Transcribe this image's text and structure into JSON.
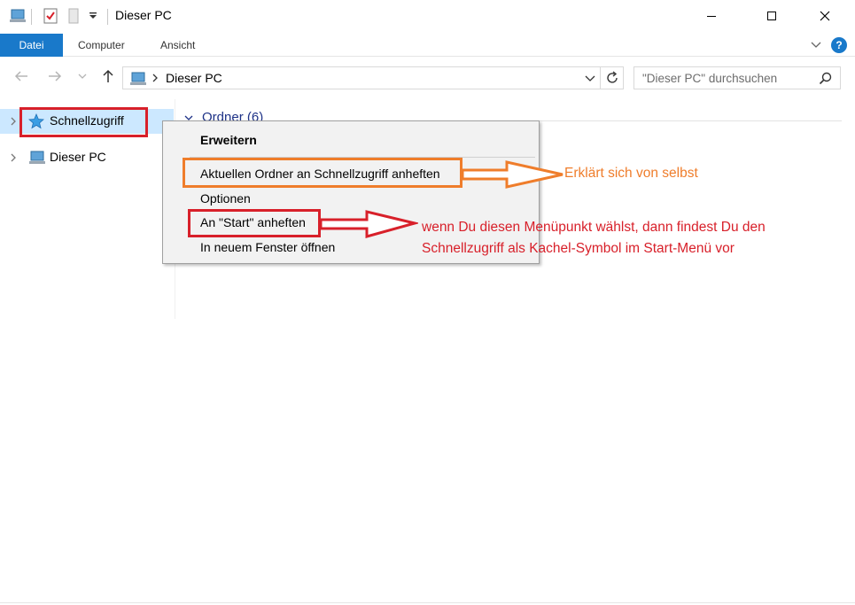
{
  "window": {
    "title": "Dieser PC"
  },
  "ribbon": {
    "tabs": [
      "Datei",
      "Computer",
      "Ansicht"
    ]
  },
  "address": {
    "path": "Dieser PC",
    "search_placeholder": "\"Dieser PC\" durchsuchen"
  },
  "nav_pane": {
    "items": [
      {
        "label": "Schnellzugriff",
        "icon": "star-icon",
        "selected": true
      },
      {
        "label": "Dieser PC",
        "icon": "computer-icon",
        "selected": false
      }
    ]
  },
  "content": {
    "group_header": "Ordner (6)"
  },
  "context_menu": {
    "items": [
      {
        "label": "Erweitern",
        "bold": true
      },
      {
        "label": "Aktuellen Ordner an Schnellzugriff anheften"
      },
      {
        "label": "Optionen"
      },
      {
        "label": "An \"Start\" anheften"
      },
      {
        "label": "In neuem Fenster öffnen"
      }
    ]
  },
  "annotations": {
    "orange_text": "Erklärt sich von selbst",
    "red_line1": "wenn Du diesen Menüpunkt wählst, dann findest Du den",
    "red_line2": "Schnellzugriff als Kachel-Symbol im Start-Menü vor"
  },
  "colors": {
    "accent": "#1979ca",
    "selection": "#cce8ff",
    "annotation_red": "#d8202a",
    "annotation_orange": "#ef7d2b"
  }
}
